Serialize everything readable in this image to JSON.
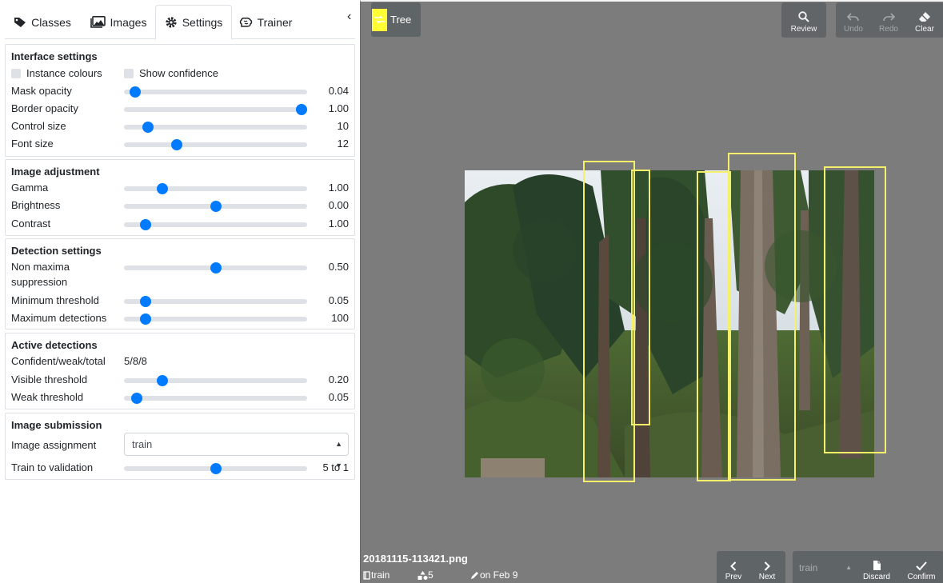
{
  "tabs": [
    {
      "label": "Classes",
      "icon": "tag-icon"
    },
    {
      "label": "Images",
      "icon": "images-icon"
    },
    {
      "label": "Settings",
      "icon": "gear-icon"
    },
    {
      "label": "Trainer",
      "icon": "brain-icon"
    }
  ],
  "active_tab": "Settings",
  "collapse_glyph": "‹",
  "interface": {
    "title": "Interface settings",
    "instance_colours": "Instance colours",
    "show_confidence": "Show confidence",
    "sliders": [
      {
        "label": "Mask opacity",
        "value": "0.04",
        "level": 0.06
      },
      {
        "label": "Border opacity",
        "value": "1.00",
        "level": 0.97
      },
      {
        "label": "Control size",
        "value": "10",
        "level": 0.13
      },
      {
        "label": "Font size",
        "value": "12",
        "level": 0.29
      }
    ]
  },
  "image_adjustment": {
    "title": "Image adjustment",
    "sliders": [
      {
        "label": "Gamma",
        "value": "1.00",
        "level": 0.21
      },
      {
        "label": "Brightness",
        "value": "0.00",
        "level": 0.5
      },
      {
        "label": "Contrast",
        "value": "1.00",
        "level": 0.12
      }
    ]
  },
  "detection": {
    "title": "Detection settings",
    "sliders": [
      {
        "label": "Non maxima",
        "label2": "suppression",
        "value": "0.50",
        "level": 0.5
      },
      {
        "label": "Minimum threshold",
        "value": "0.05",
        "level": 0.12
      },
      {
        "label": "Maximum detections",
        "value": "100",
        "level": 0.12
      }
    ]
  },
  "active": {
    "title": "Active detections",
    "counts_label": "Confident/weak/total",
    "counts_value": "5/8/8",
    "sliders": [
      {
        "label": "Visible threshold",
        "value": "0.20",
        "level": 0.21
      },
      {
        "label": "Weak threshold",
        "value": "0.05",
        "level": 0.07
      }
    ]
  },
  "submission": {
    "title": "Image submission",
    "assignment_label": "Image assignment",
    "assignment_value": "train",
    "ratio_label": "Train to validation",
    "ratio_value": "5 to 1",
    "ratio_level": 0.5
  },
  "viewer": {
    "class_name": "Tree",
    "class_color": "#ffff33",
    "buttons": {
      "review": "Review",
      "undo": "Undo",
      "redo": "Redo",
      "clear": "Clear",
      "prev": "Prev",
      "next": "Next",
      "discard": "Discard",
      "confirm": "Confirm"
    },
    "file_name": "20181115-113421.png",
    "file_set": "train",
    "file_count": "5",
    "file_date": "on Feb 9",
    "footer_select": "train"
  },
  "colors": {
    "accent": "#007bff",
    "viewer_bg": "#7c7c7c",
    "toolbar_bg": "#5f6466",
    "box_color": "#f4f06a"
  }
}
